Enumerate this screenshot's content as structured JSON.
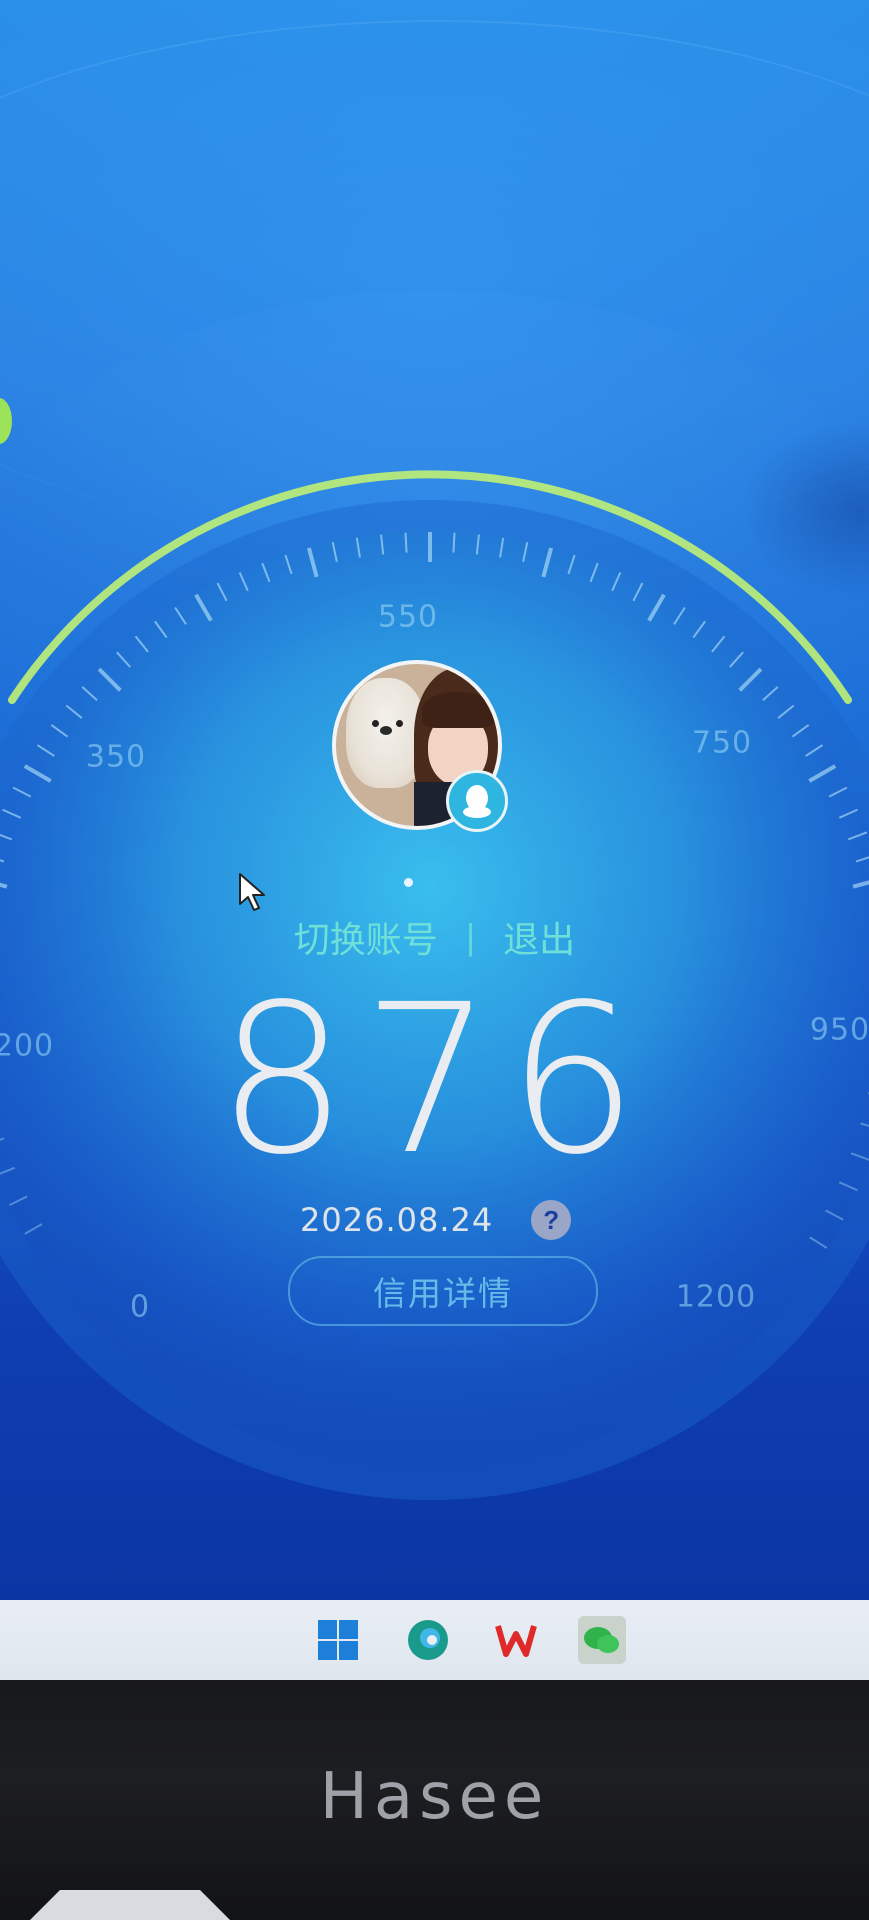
{
  "gauge": {
    "tick_labels": [
      "0",
      "200",
      "350",
      "550",
      "750",
      "950",
      "1200"
    ]
  },
  "account": {
    "switch_label": "切换账号",
    "separator": "|",
    "logout_label": "退出"
  },
  "score": {
    "value": "876",
    "date": "2026.08.24",
    "help_symbol": "?"
  },
  "credit_button": {
    "label": "信用详情"
  },
  "taskbar": {
    "icons": [
      "windows-start-icon",
      "edge-browser-icon",
      "wps-office-icon",
      "wechat-icon"
    ]
  },
  "monitor": {
    "brand": "Hasee"
  },
  "colors": {
    "accent_text": "#6fe0d8",
    "ring_green": "#b7ea7a",
    "background_top": "#2a8fe8",
    "background_bottom": "#0b35a3"
  }
}
